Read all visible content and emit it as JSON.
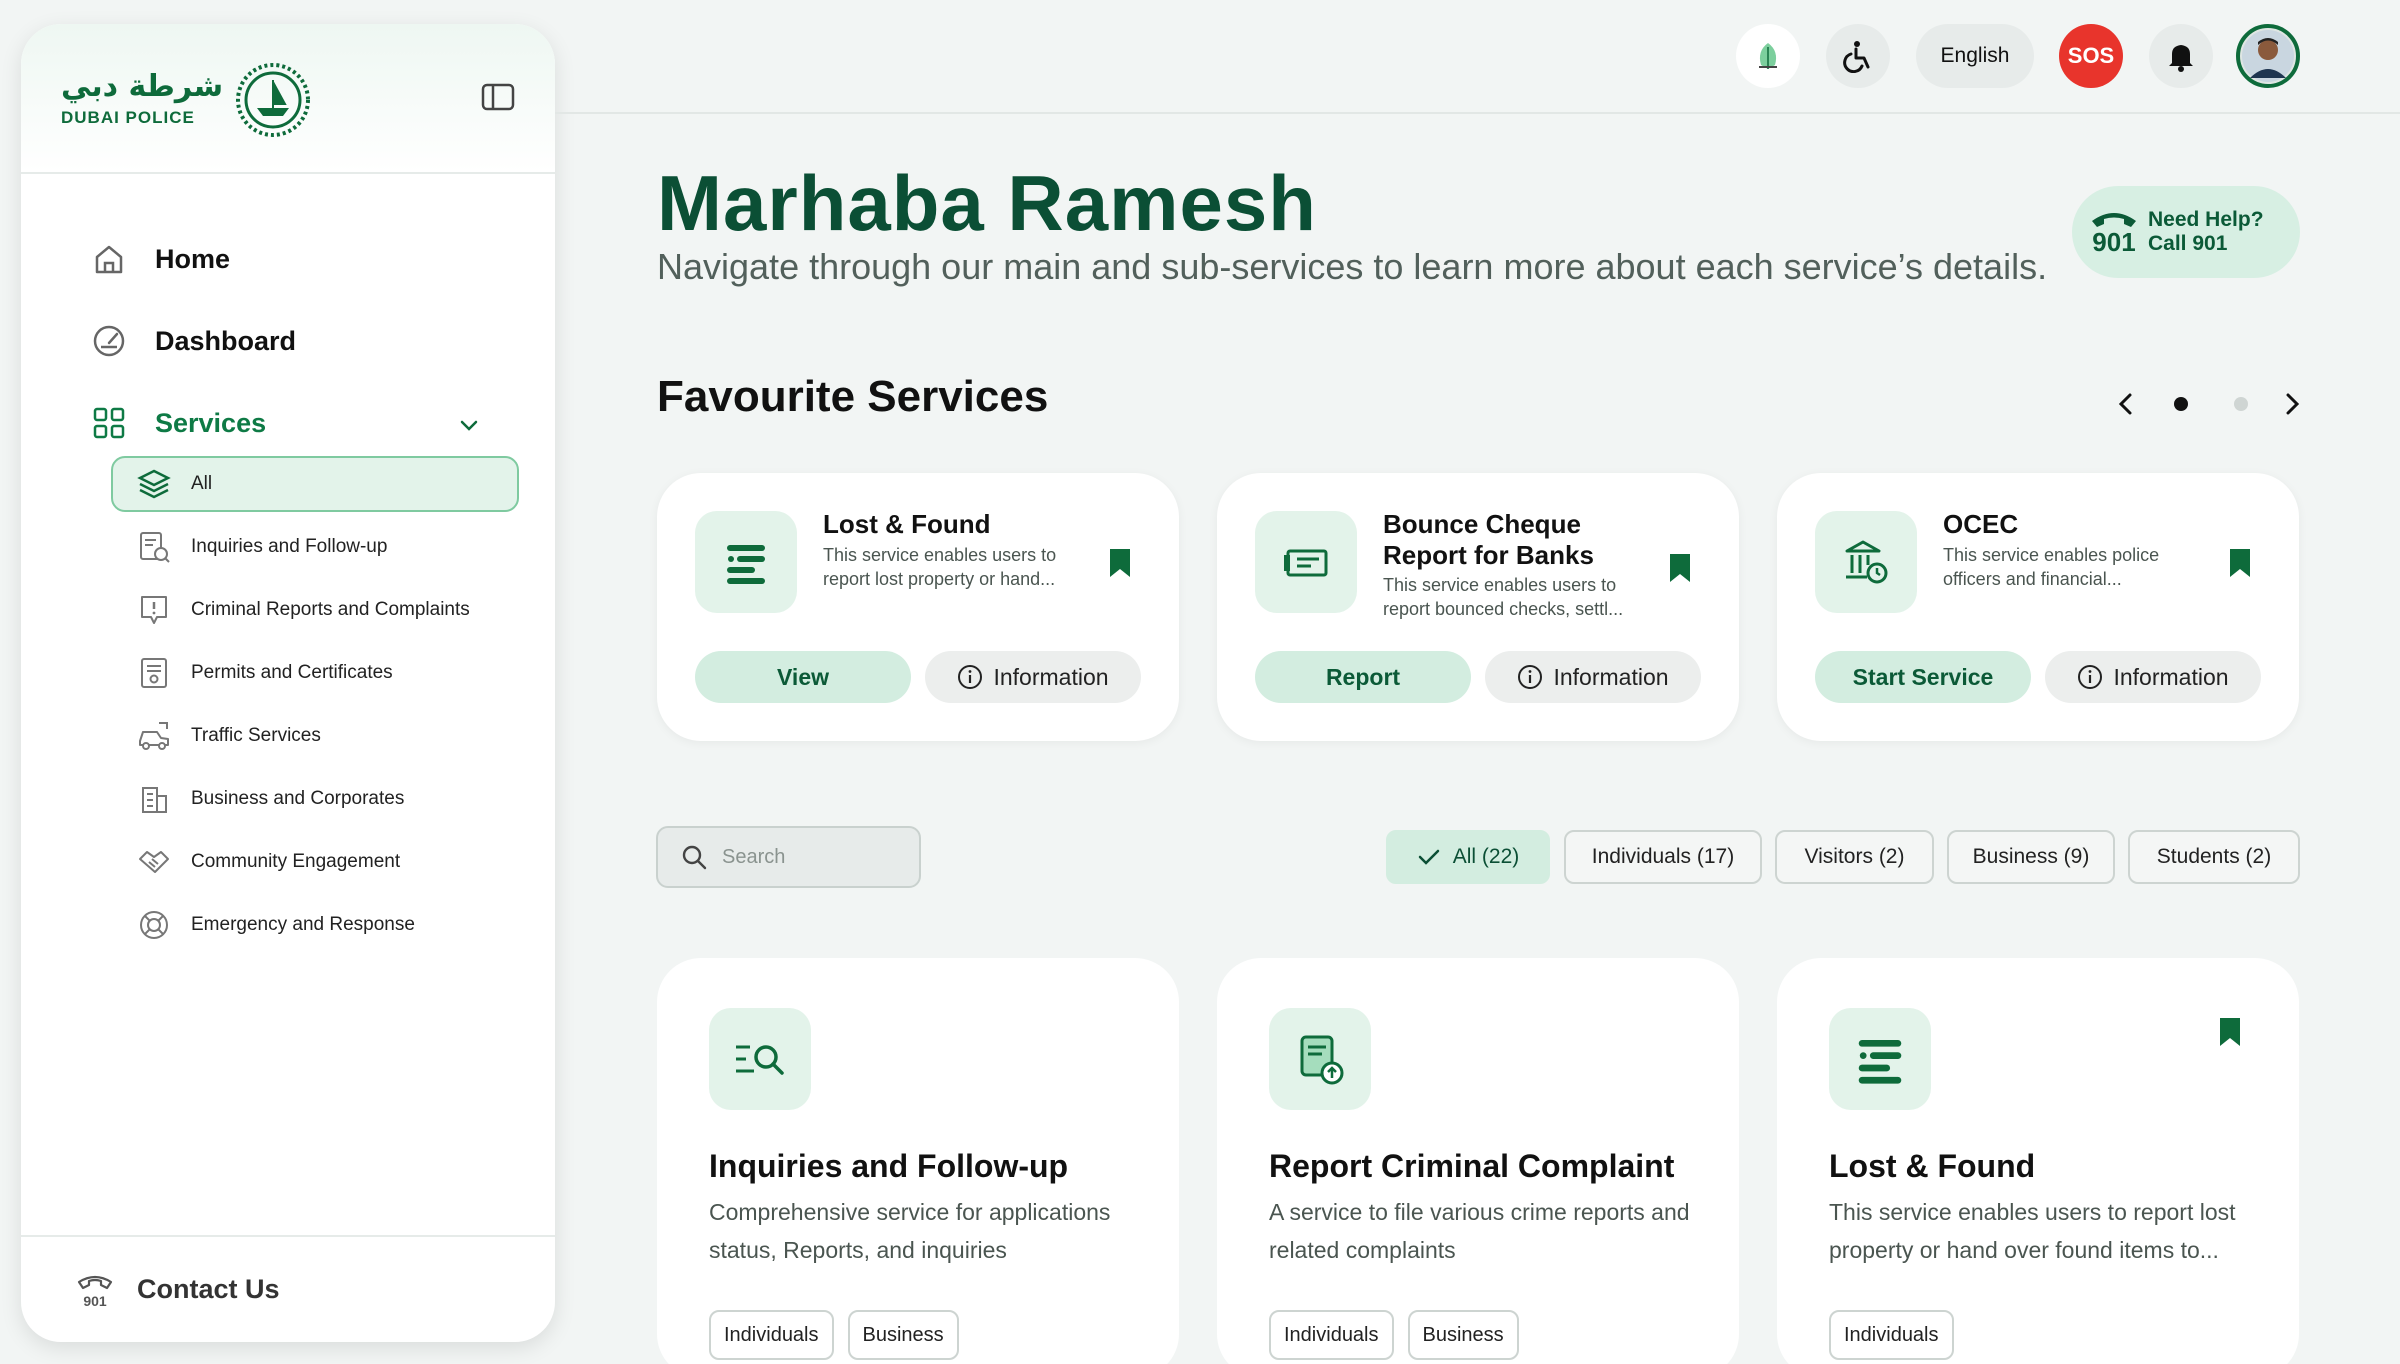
{
  "brand": {
    "arabic": "شرطة دبي",
    "english": "DUBAI POLICE"
  },
  "sidebar": {
    "nav": [
      {
        "label": "Home",
        "icon": "home-icon"
      },
      {
        "label": "Dashboard",
        "icon": "dashboard-icon"
      },
      {
        "label": "Services",
        "icon": "grid-icon"
      }
    ],
    "sub_items": [
      {
        "label": "All",
        "icon": "layers-icon"
      },
      {
        "label": "Inquiries and Follow-up",
        "icon": "document-search-icon"
      },
      {
        "label": "Criminal Reports and Complaints",
        "icon": "report-alert-icon"
      },
      {
        "label": "Permits and Certificates",
        "icon": "certificate-icon"
      },
      {
        "label": "Traffic Services",
        "icon": "traffic-car-icon"
      },
      {
        "label": "Business and Corporates",
        "icon": "building-icon"
      },
      {
        "label": "Community Engagement",
        "icon": "handshake-icon"
      },
      {
        "label": "Emergency and Response",
        "icon": "lifebuoy-icon"
      }
    ],
    "contact": {
      "label": "Contact Us",
      "icon_text": "901"
    }
  },
  "topbar": {
    "language": "English",
    "sos": "SOS"
  },
  "main": {
    "greeting": "Marhaba Ramesh",
    "subtitle": "Navigate through our main and sub-services to learn more about each service’s details.",
    "help": {
      "number": "901",
      "line1": "Need Help?",
      "line2": "Call 901"
    },
    "favourites_title": "Favourite Services",
    "favourites": [
      {
        "name": "Lost & Found",
        "desc": "This service enables users to report lost property or hand...",
        "action": "View",
        "info": "Information"
      },
      {
        "name": "Bounce Cheque Report for Banks",
        "desc": "This service enables users to report bounced checks, settl...",
        "action": "Report",
        "info": "Information"
      },
      {
        "name": "OCEC",
        "desc": "This service enables police officers and financial...",
        "action": "Start Service",
        "info": "Information"
      }
    ],
    "search_placeholder": "Search",
    "filters": [
      "All (22)",
      "Individuals (17)",
      "Visitors (2)",
      "Business (9)",
      "Students (2)"
    ],
    "services": [
      {
        "title": "Inquiries and Follow-up",
        "desc": "Comprehensive service for applications status, Reports, and inquiries",
        "tags": [
          "Individuals",
          "Business"
        ]
      },
      {
        "title": "Report Criminal Complaint",
        "desc": "A service to file various crime reports and related complaints",
        "tags": [
          "Individuals",
          "Business"
        ]
      },
      {
        "title": "Lost & Found",
        "desc": "This service enables users to report lost property or hand over found items to...",
        "tags": [
          "Individuals"
        ]
      }
    ]
  },
  "colors": {
    "brand_green": "#0e6b3b",
    "accent_light": "#d3ede0",
    "sos_red": "#e8342c"
  }
}
